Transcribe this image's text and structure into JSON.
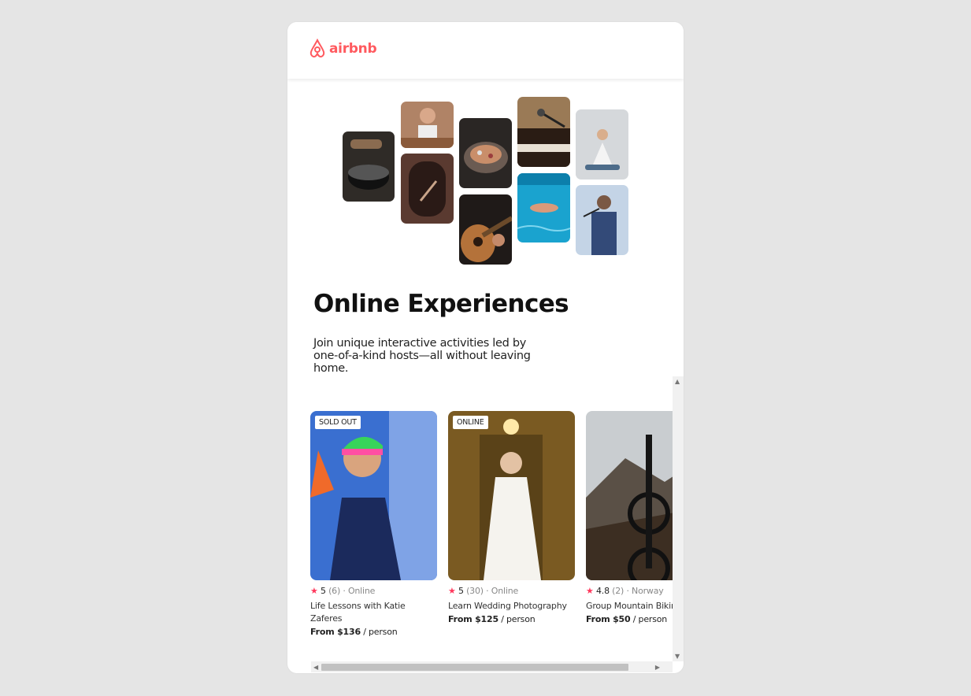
{
  "brand": {
    "logo_text": "airbnb",
    "color": "#ff5a5f"
  },
  "hero": {
    "title": "Online Experiences",
    "subtitle": "Join unique interactive activities led by one-of-a-kind hosts—all without leaving home."
  },
  "cards": [
    {
      "badge": "SOLD OUT",
      "rating": "5",
      "reviews": "(6)",
      "location": "· Online",
      "title": "Life Lessons with Katie Zaferes",
      "price": "From $136",
      "unit": " / person"
    },
    {
      "badge": "ONLINE",
      "rating": "5",
      "reviews": "(30)",
      "location": "· Online",
      "title": "Learn Wedding Photography",
      "price": "From $125",
      "unit": " / person"
    },
    {
      "badge": "",
      "rating": "4.8",
      "reviews": "(2)",
      "location": "· Norway",
      "title": "Group Mountain Biking",
      "price": "From $50",
      "unit": " / person"
    }
  ],
  "icons": {
    "star": "star-icon",
    "logo": "airbnb-logo-icon"
  },
  "colors": {
    "accent": "#ff385c",
    "background": "#e5e5e5"
  }
}
